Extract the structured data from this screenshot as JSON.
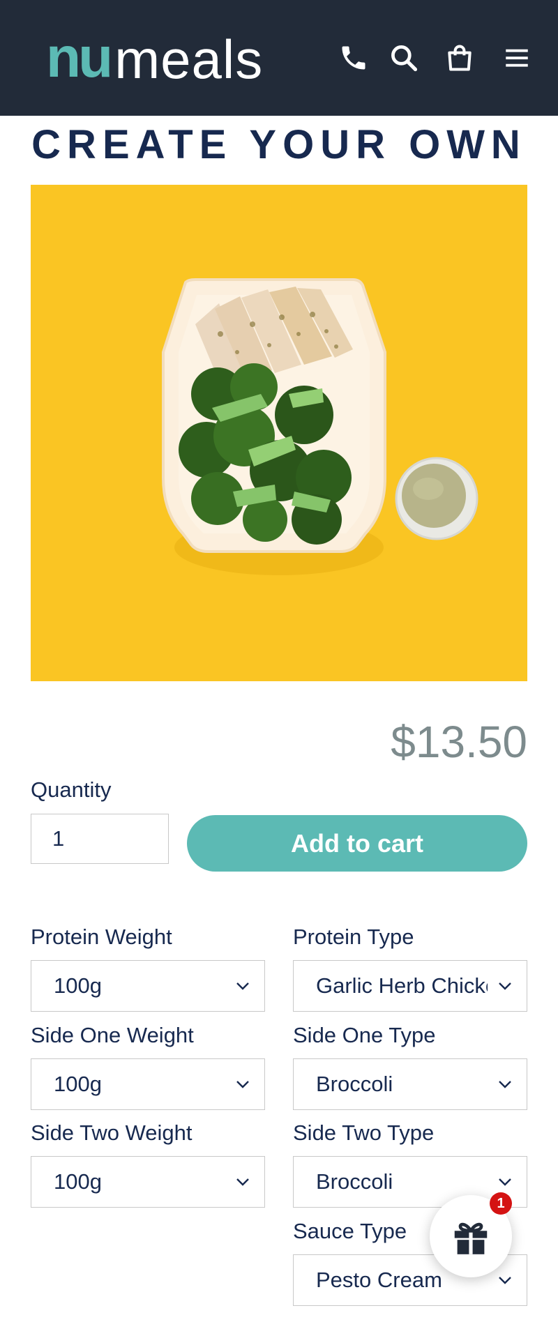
{
  "header": {
    "logo_part1": "nu",
    "logo_part2": "meals",
    "icons": [
      "phone-icon",
      "search-icon",
      "cart-icon",
      "menu-icon"
    ]
  },
  "product": {
    "title": "CREATE YOUR OWN",
    "price": "$13.50"
  },
  "purchase": {
    "quantity_label": "Quantity",
    "quantity_value": "1",
    "add_to_cart_label": "Add to cart"
  },
  "options": {
    "protein_weight": {
      "label": "Protein Weight",
      "value": "100g"
    },
    "protein_type": {
      "label": "Protein Type",
      "value": "Garlic Herb Chicken"
    },
    "side_one_weight": {
      "label": "Side One Weight",
      "value": "100g"
    },
    "side_one_type": {
      "label": "Side One Type",
      "value": "Broccoli"
    },
    "side_two_weight": {
      "label": "Side Two Weight",
      "value": "100g"
    },
    "side_two_type": {
      "label": "Side Two Type",
      "value": "Broccoli"
    },
    "sauce_type": {
      "label": "Sauce Type",
      "value": "Pesto Cream"
    }
  },
  "gift_widget": {
    "badge_count": "1"
  },
  "colors": {
    "header_bg": "#222b39",
    "brand_teal": "#5cbab4",
    "title_navy": "#17294f",
    "hero_yellow": "#fac523",
    "badge_red": "#d41313"
  }
}
